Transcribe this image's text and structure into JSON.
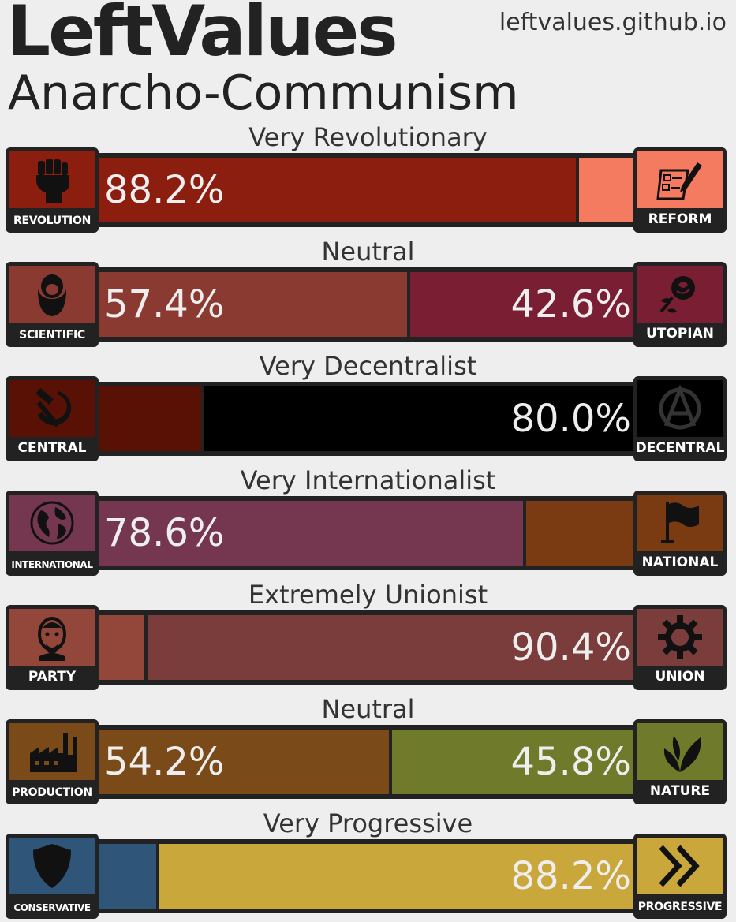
{
  "header": {
    "brand": "LeftValues",
    "site": "leftvalues.github.io",
    "ideology": "Anarcho-Communism"
  },
  "axes": [
    {
      "label": "Very Revolutionary",
      "left": {
        "name": "REVOLUTION",
        "icon": "raised-fist-icon",
        "color": "#8b1e0f"
      },
      "right": {
        "name": "REFORM",
        "icon": "ballot-icon",
        "color": "#f47a60"
      },
      "left_value": 88.2,
      "right_value": 11.8,
      "left_pct": "88.2%",
      "right_pct": ""
    },
    {
      "label": "Neutral",
      "left": {
        "name": "SCIENTIFIC",
        "icon": "marx-portrait-icon",
        "color": "#8b3a32"
      },
      "right": {
        "name": "UTOPIAN",
        "icon": "rose-icon",
        "color": "#7a1e33"
      },
      "left_value": 57.4,
      "right_value": 42.6,
      "left_pct": "57.4%",
      "right_pct": "42.6%"
    },
    {
      "label": "Very Decentralist",
      "left": {
        "name": "CENTRAL",
        "icon": "hammer-sickle-icon",
        "color": "#5a1105"
      },
      "right": {
        "name": "DECENTRAL",
        "icon": "anarchy-icon",
        "color": "#000000"
      },
      "left_value": 20.0,
      "right_value": 80.0,
      "left_pct": "",
      "right_pct": "80.0%"
    },
    {
      "label": "Very Internationalist",
      "left": {
        "name": "INTERNATIONAL",
        "icon": "globe-icon",
        "color": "#74374f"
      },
      "right": {
        "name": "NATIONAL",
        "icon": "flag-icon",
        "color": "#7a3a12"
      },
      "left_value": 78.6,
      "right_value": 21.4,
      "left_pct": "78.6%",
      "right_pct": ""
    },
    {
      "label": "Extremely Unionist",
      "left": {
        "name": "PARTY",
        "icon": "lenin-portrait-icon",
        "color": "#93473a"
      },
      "right": {
        "name": "UNION",
        "icon": "gear-icon",
        "color": "#7b3d3b"
      },
      "left_value": 9.6,
      "right_value": 90.4,
      "left_pct": "",
      "right_pct": "90.4%"
    },
    {
      "label": "Neutral",
      "left": {
        "name": "PRODUCTION",
        "icon": "factory-icon",
        "color": "#7a4a18"
      },
      "right": {
        "name": "NATURE",
        "icon": "leaves-icon",
        "color": "#6f7a2a"
      },
      "left_value": 54.2,
      "right_value": 45.8,
      "left_pct": "54.2%",
      "right_pct": "45.8%"
    },
    {
      "label": "Very Progressive",
      "left": {
        "name": "CONSERVATIVE",
        "icon": "shield-icon",
        "color": "#2f5578"
      },
      "right": {
        "name": "PROGRESSIVE",
        "icon": "double-chevron-icon",
        "color": "#c9a73a"
      },
      "left_value": 11.8,
      "right_value": 88.2,
      "left_pct": "",
      "right_pct": "88.2%"
    }
  ]
}
